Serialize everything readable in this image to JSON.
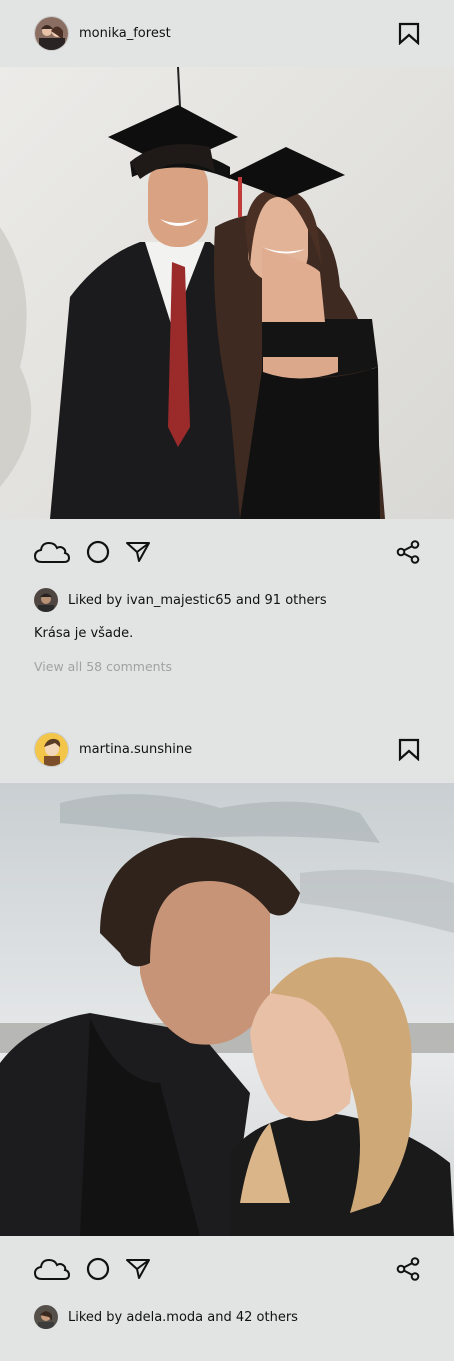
{
  "posts": [
    {
      "username": "monika_forest",
      "avatar_icon": "avatar-graduation-couple",
      "photo_desc": "graduation couple photo",
      "likes_text": "Liked by ivan_majestic65 and 91 others",
      "caption": "Krása je všade.",
      "comments_link": "View all 58 comments"
    },
    {
      "username": "martina.sunshine",
      "avatar_icon": "avatar-cartoon-boy",
      "photo_desc": "couple embracing outdoors photo",
      "likes_text": "Liked by adela.moda and 42 others"
    }
  ],
  "icons": {
    "bookmark": "bookmark-icon",
    "like": "cloud-like-icon",
    "comment": "circle-comment-icon",
    "send": "paper-plane-icon",
    "share": "share-icon"
  },
  "colors": {
    "background": "#e2e4e3",
    "text": "#111111",
    "muted": "#a0a3a3"
  }
}
